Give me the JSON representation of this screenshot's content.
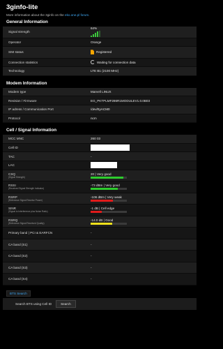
{
  "app": {
    "title": "3ginfo-lite",
    "desc_prefix": "More information about the 3ginfo on the ",
    "desc_link": "eko.one.pl forum",
    "desc_suffix": "."
  },
  "general": {
    "title": "General Information",
    "signal_label": "Signal strength",
    "signal_percent": "64%",
    "signal_level": 0.64,
    "signal_color": "#3bc83b",
    "operator_label": "Operator",
    "operator_value": "Orange",
    "sim_label": "SIM status",
    "sim_value": "Registered",
    "sim_icon": "sim-card-icon",
    "conn_label": "Connection statistics",
    "conn_value": "Waiting for connection data",
    "conn_icon": "spinner-icon",
    "tech_label": "Technology",
    "tech_value": "LTE B1 (2100 MHz)"
  },
  "modem": {
    "title": "Modem Information",
    "type_label": "Modem type",
    "type_value": "Marvell LINUX",
    "rev_label": "Revision / Firmware",
    "rev_value": "EG_PKTPLMF286R1MODULEV1.0.0B03",
    "ip_label": "IP adress / Communication Port",
    "ip_value": "/dev/ttyACM0",
    "proto_label": "Protocol",
    "proto_value": "ncm"
  },
  "cell": {
    "title": "Cell / Signal Information",
    "mccmnc_label": "MCC MNC",
    "mccmnc_value": "260 03",
    "cellid_label": "Cell ID",
    "tac_label": "TAC",
    "tac_value": "-",
    "lac_label": "LAC",
    "csq_label": "CSQ",
    "csq_sub": "(Signal Strength)",
    "csq_value": "20 | Very good",
    "csq_level": 0.9,
    "csq_color": "#2ecc2e",
    "rssi_label": "RSSI",
    "rssi_sub": "(Received Signal Strength Indicator)",
    "rssi_value": "-73 dBm | Very good",
    "rssi_level": 0.75,
    "rssi_color": "#2ecc2e",
    "rsrp_label": "RSRP",
    "rsrp_sub": "(Reference Signal Receive Power)",
    "rsrp_value": "-106 dBm | Very weak",
    "rsrp_level": 0.62,
    "rsrp_color": "#e01b1b",
    "sinr_label": "SINR",
    "sinr_sub": "(Signal to Interference plus Noise Ratio)",
    "sinr_value": "-1 dB | Cell edge",
    "sinr_level": 0.3,
    "sinr_color": "#e01b1b",
    "rsrq_label": "RSRQ",
    "rsrq_sub": "(Reference Signal Received Quality)",
    "rsrq_value": "-14.0 dB | Good",
    "rsrq_level": 0.6,
    "rsrq_color": "#f0e01c",
    "pband_label": "Primary band | PCI & EARFCN",
    "pband_value": "-",
    "ca1_label": "CA band (S1)",
    "ca1_value": "-",
    "ca2_label": "CA band (S2)",
    "ca2_value": "-",
    "ca3_label": "CA band (S3)",
    "ca3_value": "-",
    "ca4_label": "CA band (S4)",
    "ca4_value": "-"
  },
  "bts": {
    "tab_label": "BTS Search",
    "search_label": "Search BTS using Cell ID",
    "search_button": "Search"
  }
}
